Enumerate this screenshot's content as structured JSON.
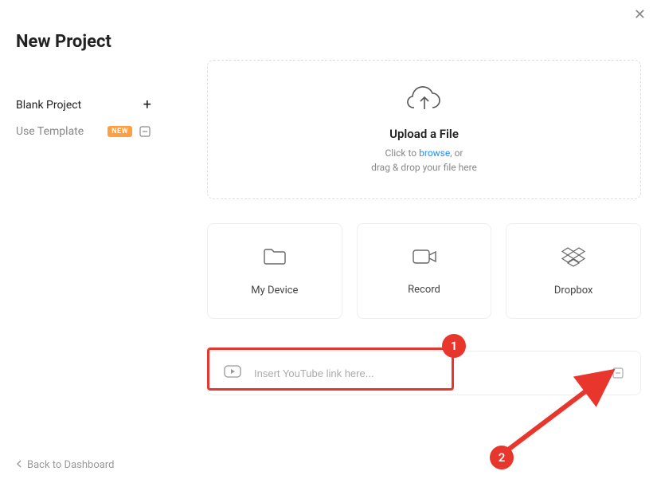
{
  "title": "New Project",
  "sidebar": {
    "blank": {
      "label": "Blank Project"
    },
    "template": {
      "label": "Use Template",
      "badge": "NEW"
    }
  },
  "back": "Back to Dashboard",
  "upload": {
    "title": "Upload a File",
    "sub_prefix": "Click to ",
    "sub_browse": "browse",
    "sub_suffix": ", or",
    "sub_line2": "drag & drop your file here"
  },
  "options": {
    "device": "My Device",
    "record": "Record",
    "dropbox": "Dropbox"
  },
  "youtube": {
    "placeholder": "Insert YouTube link here..."
  },
  "annotations": {
    "one": "1",
    "two": "2"
  }
}
